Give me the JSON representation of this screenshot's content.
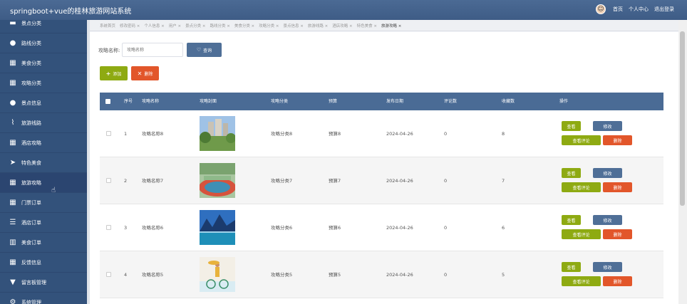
{
  "header": {
    "title": "springboot+vue的桂林旅游网站系统",
    "links": [
      "首页",
      "个人中心",
      "退出登录"
    ]
  },
  "sidebar": {
    "items": [
      {
        "label": "景点分类",
        "icon": "chat-icon"
      },
      {
        "label": "路线分类",
        "icon": "user-icon"
      },
      {
        "label": "美食分类",
        "icon": "grid-icon"
      },
      {
        "label": "攻略分类",
        "icon": "grid-icon"
      },
      {
        "label": "景点信息",
        "icon": "user-icon"
      },
      {
        "label": "旅游线路",
        "icon": "chart-icon"
      },
      {
        "label": "酒店攻略",
        "icon": "grid-icon"
      },
      {
        "label": "特色美食",
        "icon": "send-icon"
      },
      {
        "label": "旅游攻略",
        "icon": "grid-icon",
        "active": true
      },
      {
        "label": "门票订单",
        "icon": "grid-icon"
      },
      {
        "label": "酒店订单",
        "icon": "list-icon"
      },
      {
        "label": "美食订单",
        "icon": "columns-icon"
      },
      {
        "label": "反馈信息",
        "icon": "grid-icon"
      },
      {
        "label": "留言板管理",
        "icon": "message-icon"
      },
      {
        "label": "系统管理",
        "icon": "gear-icon"
      }
    ]
  },
  "tabs": [
    "系统首页",
    "修改密码 ×",
    "个人信息 ×",
    "用户 ×",
    "景点分类 ×",
    "路线分类 ×",
    "美食分类 ×",
    "攻略分类 ×",
    "景点信息 ×",
    "旅游线路 ×",
    "酒店攻略 ×",
    "特色美食 ×",
    "旅游攻略 ×"
  ],
  "active_tab_index": 12,
  "search": {
    "label": "攻略名称:",
    "placeholder": "攻略名称",
    "button": "查询"
  },
  "actions": {
    "add": "添加",
    "delete": "删除"
  },
  "table": {
    "columns": [
      "序号",
      "攻略名称",
      "攻略封面",
      "攻略分类",
      "预算",
      "发布日期",
      "评论数",
      "收藏数",
      "操作"
    ],
    "rows": [
      {
        "no": "1",
        "name": "攻略名称8",
        "category": "攻略分类8",
        "budget": "预算8",
        "date": "2024-04-26",
        "comments": "0",
        "favorites": "8",
        "thumb": "city-park"
      },
      {
        "no": "2",
        "name": "攻略名称7",
        "category": "攻略分类7",
        "budget": "预算7",
        "date": "2024-04-26",
        "comments": "0",
        "favorites": "7",
        "thumb": "running-track"
      },
      {
        "no": "3",
        "name": "攻略名称6",
        "category": "攻略分类6",
        "budget": "预算6",
        "date": "2024-04-26",
        "comments": "0",
        "favorites": "6",
        "thumb": "mountain-lake"
      },
      {
        "no": "4",
        "name": "攻略名称5",
        "category": "攻略分类5",
        "budget": "预算5",
        "date": "2024-04-26",
        "comments": "0",
        "favorites": "5",
        "thumb": "cyclist-beach"
      }
    ],
    "row_buttons": {
      "view": "查看",
      "edit": "修改",
      "comment": "查看评论",
      "delete": "删除"
    }
  },
  "colors": {
    "header": "#3e5c86",
    "sidebar": "#33527b",
    "primary": "#4f6f97",
    "success": "#8eaa12",
    "danger": "#e2562a"
  }
}
